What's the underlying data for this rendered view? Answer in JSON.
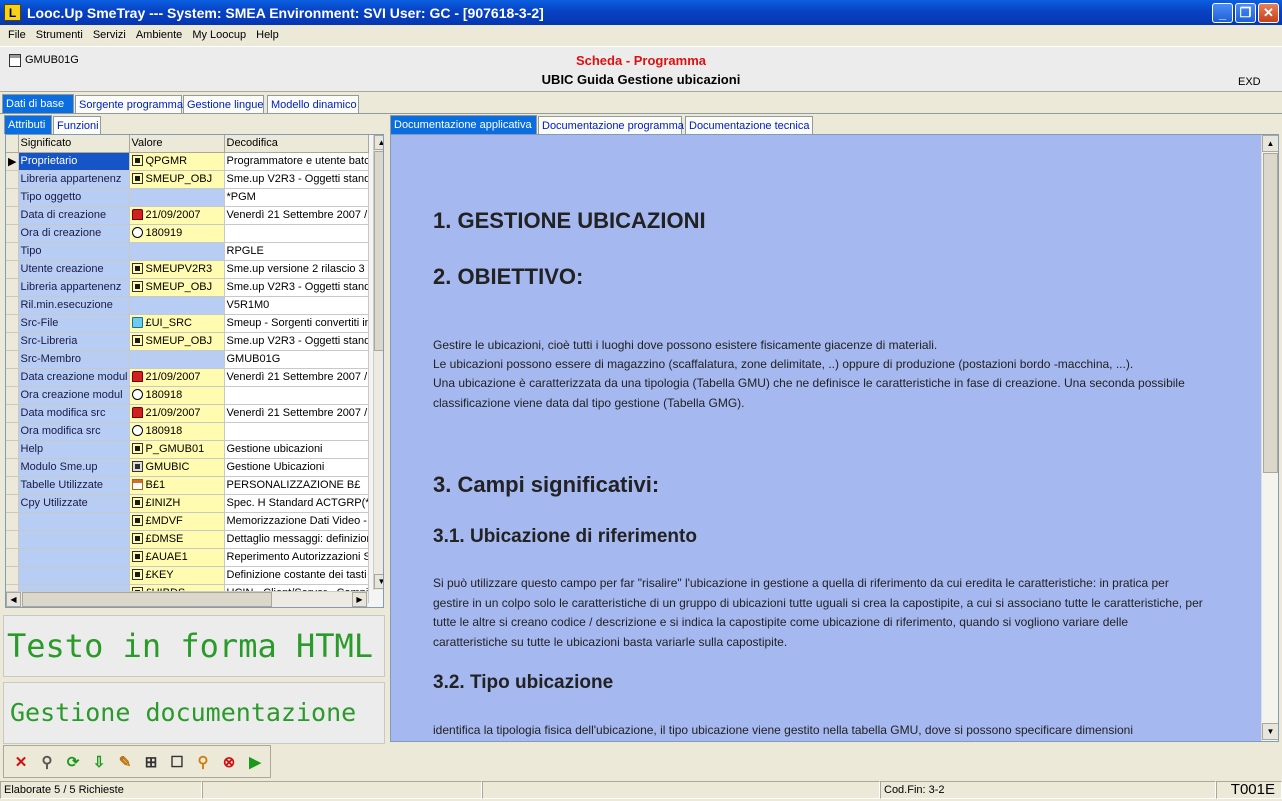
{
  "window": {
    "title": "Looc.Up SmeTray --- System: SMEA Environment: SVI User: GC - [907618-3-2]",
    "logo": "L"
  },
  "menu": [
    "File",
    "Strumenti",
    "Servizi",
    "Ambiente",
    "My Loocup",
    "Help"
  ],
  "header": {
    "object_code": "GMUB01G",
    "type_label": "Scheda - Programma",
    "title": "UBIC Guida Gestione ubicazioni",
    "right_label": "EXD"
  },
  "main_tabs": [
    "Dati di base",
    "Sorgente programma",
    "Gestione lingue",
    "Modello dinamico"
  ],
  "sub_tabs": [
    "Attributi",
    "Funzioni"
  ],
  "doc_tabs": [
    "Documentazione applicativa",
    "Documentazione programma",
    "Documentazione tecnica"
  ],
  "grid": {
    "columns": [
      "Significato",
      "Valore",
      "Decodifica"
    ],
    "rows": [
      {
        "sig": "Proprietario",
        "icon": "obj",
        "val": "QPGMR",
        "dec": "Programmatore e utente batch"
      },
      {
        "sig": "Libreria appartenenz",
        "icon": "obj",
        "val": "SMEUP_OBJ",
        "dec": "Sme.up V2R3 - Oggetti standard"
      },
      {
        "sig": "Tipo oggetto",
        "icon": "",
        "val": "",
        "dec": "*PGM"
      },
      {
        "sig": "Data di creazione",
        "icon": "dat",
        "val": "21/09/2007",
        "dec": "Venerdì 21 Settembre 2007 /"
      },
      {
        "sig": "Ora  di creazione",
        "icon": "ora",
        "val": "180919",
        "dec": ""
      },
      {
        "sig": "Tipo",
        "icon": "",
        "val": "",
        "dec": "RPGLE"
      },
      {
        "sig": "Utente  creazione",
        "icon": "obj",
        "val": "SMEUPV2R3",
        "dec": "Sme.up versione 2 rilascio 3"
      },
      {
        "sig": "Libreria appartenenz",
        "icon": "obj",
        "val": "SMEUP_OBJ",
        "dec": "Sme.up V2R3 - Oggetti standard"
      },
      {
        "sig": "Ril.min.esecuzione",
        "icon": "",
        "val": "",
        "dec": "V5R1M0"
      },
      {
        "sig": "Src-File",
        "icon": "fld",
        "val": "£UI_SRC",
        "dec": "Smeup - Sorgenti convertiti in"
      },
      {
        "sig": "Src-Libreria",
        "icon": "obj",
        "val": "SMEUP_OBJ",
        "dec": "Sme.up V2R3 - Oggetti standard"
      },
      {
        "sig": "Src-Membro",
        "icon": "",
        "val": "",
        "dec": "GMUB01G"
      },
      {
        "sig": "Data creazione modul",
        "icon": "dat",
        "val": "21/09/2007",
        "dec": "Venerdì 21 Settembre 2007 /"
      },
      {
        "sig": "Ora  creazione modul",
        "icon": "ora",
        "val": "180918",
        "dec": ""
      },
      {
        "sig": "Data modifica  src",
        "icon": "dat",
        "val": "21/09/2007",
        "dec": "Venerdì 21 Settembre 2007 /"
      },
      {
        "sig": "Ora  modifica  src",
        "icon": "ora",
        "val": "180918",
        "dec": ""
      },
      {
        "sig": "Help",
        "icon": "obj",
        "val": "P_GMUB01",
        "dec": "Gestione ubicazioni"
      },
      {
        "sig": "Modulo Sme.up",
        "icon": "mod",
        "val": "GMUBIC",
        "dec": "Gestione Ubicazioni"
      },
      {
        "sig": "Tabelle Utilizzate",
        "icon": "tab",
        "val": "B£1",
        "dec": "PERSONALIZZAZIONE B£"
      },
      {
        "sig": "Cpy Utilizzate",
        "icon": "obj",
        "val": "£INIZH",
        "dec": "Spec. H Standard ACTGRP(*C"
      },
      {
        "sig": "",
        "icon": "obj",
        "val": "£MDVF",
        "dec": "Memorizzazione Dati Video - S"
      },
      {
        "sig": "",
        "icon": "obj",
        "val": "£DMSE",
        "dec": "Dettaglio messaggi: definizioni"
      },
      {
        "sig": "",
        "icon": "obj",
        "val": "£AUAE1",
        "dec": "Reperimento Autorizzazioni Sp"
      },
      {
        "sig": "",
        "icon": "obj",
        "val": "£KEY",
        "dec": "Definizione costante dei tasti f"
      },
      {
        "sig": "",
        "icon": "obj",
        "val": "£UIBDS",
        "dec": "UCIN - Client/Server - Campi"
      }
    ]
  },
  "bigbox1": "Testo in forma HTML",
  "bigbox2": "Gestione documentazione",
  "doc": {
    "h1_1": "1.  GESTIONE UBICAZIONI",
    "h1_2": "2.  OBIETTIVO:",
    "p1": "Gestire le ubicazioni, cioè tutti i luoghi dove possono esistere fisicamente giacenze di materiali.",
    "p2": "Le ubicazioni possono essere di magazzino (scaffalatura, zone delimitate, ..) oppure di produzione (postazioni bordo -macchina, ...).",
    "p3": "Una ubicazione è caratterizzata da una tipologia (Tabella GMU) che ne definisce le caratteristiche in fase di creazione. Una seconda possibile classificazione viene data dal tipo gestione (Tabella GMG).",
    "h1_3": "3.  Campi significativi:",
    "h2_1": "3.1.  Ubicazione di riferimento",
    "p4": "Si può utilizzare questo campo per far \"risalire\" l'ubicazione in gestione a quella di riferimento da cui eredita le caratteristiche: in pratica per gestire in un colpo solo le caratteristiche di un gruppo di ubicazioni tutte uguali si crea la capostipite, a cui si associano tutte le caratteristiche, per tutte le altre si creano codice / descrizione e si indica la capostipite come ubicazione di riferimento, quando si vogliono variare delle caratteristiche su tutte le ubicazioni basta variarle sulla capostipite.",
    "h2_2": "3.2.  Tipo ubicazione",
    "p5": "identifica la tipologia fisica dell'ubicazione, il tipo ubicazione viene gestito nella tabella GMU, dove si possono specificare dimensioni"
  },
  "toolbar_icons": [
    "close-icon",
    "search-icon",
    "refresh-icon",
    "export-icon",
    "edit-icon",
    "cart-icon",
    "note-icon",
    "zoom-icon",
    "stop-icon",
    "play-icon"
  ],
  "status": {
    "left": "Elaborate 5 / 5 Richieste",
    "codfin": "Cod.Fin: 3-2",
    "code": "T001E"
  }
}
